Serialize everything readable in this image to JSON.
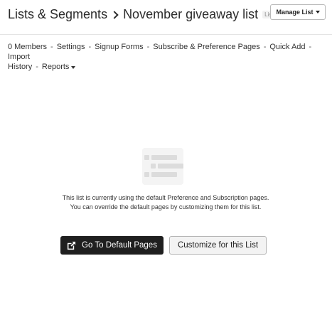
{
  "header": {
    "breadcrumb_root": "Lists & Segments",
    "list_name": "November giveaway list",
    "type_badge": "List",
    "manage_button_label": "Manage List"
  },
  "subnav": {
    "items": [
      "0 Members",
      "Settings",
      "Signup Forms",
      "Subscribe & Preference Pages",
      "Quick Add",
      "Import",
      "History",
      "Reports"
    ],
    "separator": "-"
  },
  "main": {
    "message": "This list is currently using the default Preference and Subscription pages. You can override the default pages by customizing them for this list.",
    "primary_button_label": "Go To Default Pages",
    "secondary_button_label": "Customize for this List"
  },
  "colors": {
    "primary_button_bg": "#1f1f1f",
    "secondary_button_bg": "#f3f3f3",
    "illustration": "#dcdcdc"
  },
  "icons": {
    "breadcrumb_separator": "chevron-right-icon",
    "manage_caret": "caret-down-icon",
    "reports_caret": "caret-down-icon",
    "primary_button_icon": "external-link-icon",
    "illustration": "list-placeholder-icon"
  }
}
